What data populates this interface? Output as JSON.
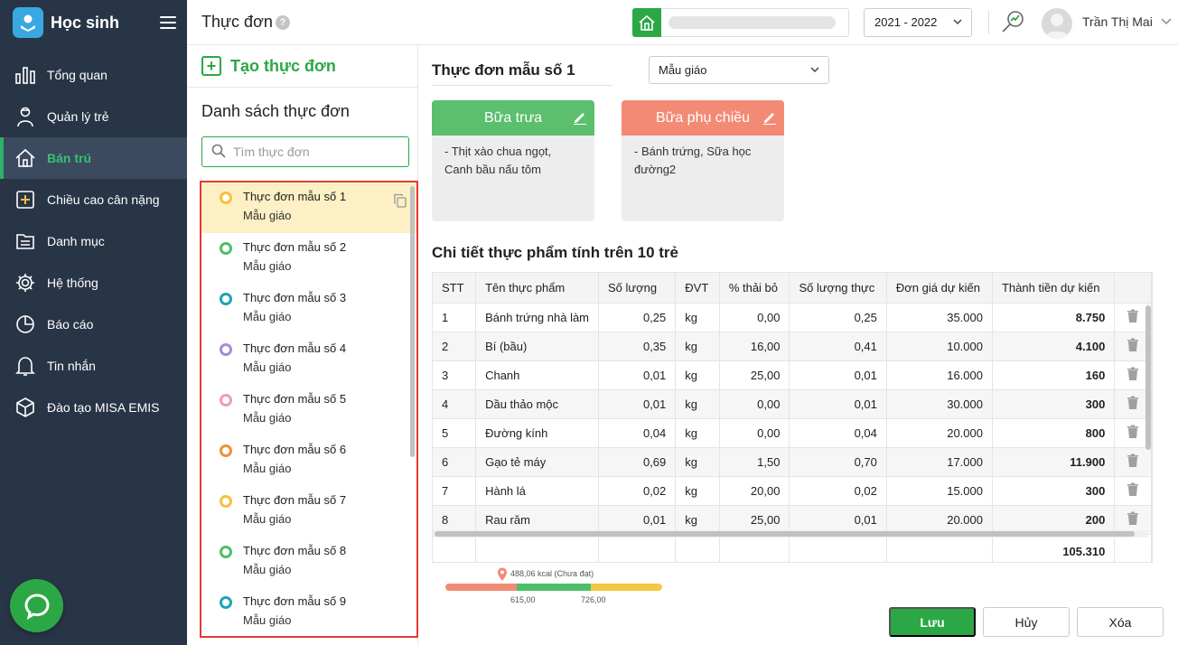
{
  "app": {
    "title": "Học sinh"
  },
  "sidebar": {
    "items": [
      {
        "label": "Tổng quan",
        "icon": "bar-chart-icon"
      },
      {
        "label": "Quản lý trẻ",
        "icon": "child-icon"
      },
      {
        "label": "Bán trú",
        "icon": "home-icon",
        "active": true
      },
      {
        "label": "Chiều cao cân nặng",
        "icon": "plus-square-icon"
      },
      {
        "label": "Danh mục",
        "icon": "folder-icon"
      },
      {
        "label": "Hệ thống",
        "icon": "gear-icon"
      },
      {
        "label": "Báo cáo",
        "icon": "pie-chart-icon"
      },
      {
        "label": "Tin nhắn",
        "icon": "bell-icon"
      },
      {
        "label": "Đào tạo MISA EMIS",
        "icon": "cube-icon"
      }
    ]
  },
  "header": {
    "title": "Thực đơn",
    "help": "?",
    "school_year": "2021 - 2022",
    "user_name": "Trần Thị Mai"
  },
  "list_panel": {
    "create_label": "Tạo thực đơn",
    "heading": "Danh sách thực đơn",
    "search_placeholder": "Tìm thực đơn",
    "items": [
      {
        "name": "Thực đơn mẫu số 1",
        "level": "Mẫu giáo",
        "color": "#f5c13d",
        "selected": true
      },
      {
        "name": "Thực đơn mẫu số 2",
        "level": "Mẫu giáo",
        "color": "#4cbf68"
      },
      {
        "name": "Thực đơn mẫu số 3",
        "level": "Mẫu giáo",
        "color": "#1ea3b5"
      },
      {
        "name": "Thực đơn mẫu số 4",
        "level": "Mẫu giáo",
        "color": "#a98ad6"
      },
      {
        "name": "Thực đơn mẫu số 5",
        "level": "Mẫu giáo",
        "color": "#f29ab5"
      },
      {
        "name": "Thực đơn mẫu số 6",
        "level": "Mẫu giáo",
        "color": "#f0913a"
      },
      {
        "name": "Thực đơn mẫu số 7",
        "level": "Mẫu giáo",
        "color": "#f5c13d"
      },
      {
        "name": "Thực đơn mẫu số 8",
        "level": "Mẫu giáo",
        "color": "#4cbf68"
      },
      {
        "name": "Thực đơn mẫu số 9",
        "level": "Mẫu giáo",
        "color": "#1ea3b5"
      }
    ]
  },
  "main": {
    "menu_title": "Thực đơn mẫu số 1",
    "level_select": "Mẫu giáo",
    "meals": [
      {
        "title": "Bữa trưa",
        "color": "#5bbf6d",
        "content": "- Thịt xào chua ngọt, Canh bầu nấu tôm"
      },
      {
        "title": "Bữa phụ chiều",
        "color": "#f28a74",
        "content": "- Bánh trứng, Sữa học đường2"
      }
    ],
    "detail_title": "Chi tiết thực phẩm tính trên 10 trẻ",
    "table": {
      "columns": [
        "STT",
        "Tên thực phẩm",
        "Số lượng",
        "ĐVT",
        "% thải bỏ",
        "Số lượng thực",
        "Đơn giá dự kiến",
        "Thành tiền dự kiến"
      ],
      "rows": [
        [
          "1",
          "Bánh trứng nhà làm",
          "0,25",
          "kg",
          "0,00",
          "0,25",
          "35.000",
          "8.750"
        ],
        [
          "2",
          "Bí (bầu)",
          "0,35",
          "kg",
          "16,00",
          "0,41",
          "10.000",
          "4.100"
        ],
        [
          "3",
          "Chanh",
          "0,01",
          "kg",
          "25,00",
          "0,01",
          "16.000",
          "160"
        ],
        [
          "4",
          "Dầu thảo mộc",
          "0,01",
          "kg",
          "0,00",
          "0,01",
          "30.000",
          "300"
        ],
        [
          "5",
          "Đường kính",
          "0,04",
          "kg",
          "0,00",
          "0,04",
          "20.000",
          "800"
        ],
        [
          "6",
          "Gạo tẻ máy",
          "0,69",
          "kg",
          "1,50",
          "0,70",
          "17.000",
          "11.900"
        ],
        [
          "7",
          "Hành lá",
          "0,02",
          "kg",
          "20,00",
          "0,02",
          "15.000",
          "300"
        ],
        [
          "8",
          "Rau răm",
          "0,01",
          "kg",
          "25,00",
          "0,01",
          "20.000",
          "200"
        ]
      ],
      "total": "105.310"
    },
    "kcal": {
      "label": "488,06 kcal (Chưa đạt)",
      "threshold_low": "615,00",
      "threshold_high": "726,00",
      "colors": {
        "low": "#f28a74",
        "mid": "#4cbf68",
        "high": "#f5c842"
      }
    },
    "buttons": {
      "save": "Lưu",
      "cancel": "Hủy",
      "delete": "Xóa"
    }
  }
}
